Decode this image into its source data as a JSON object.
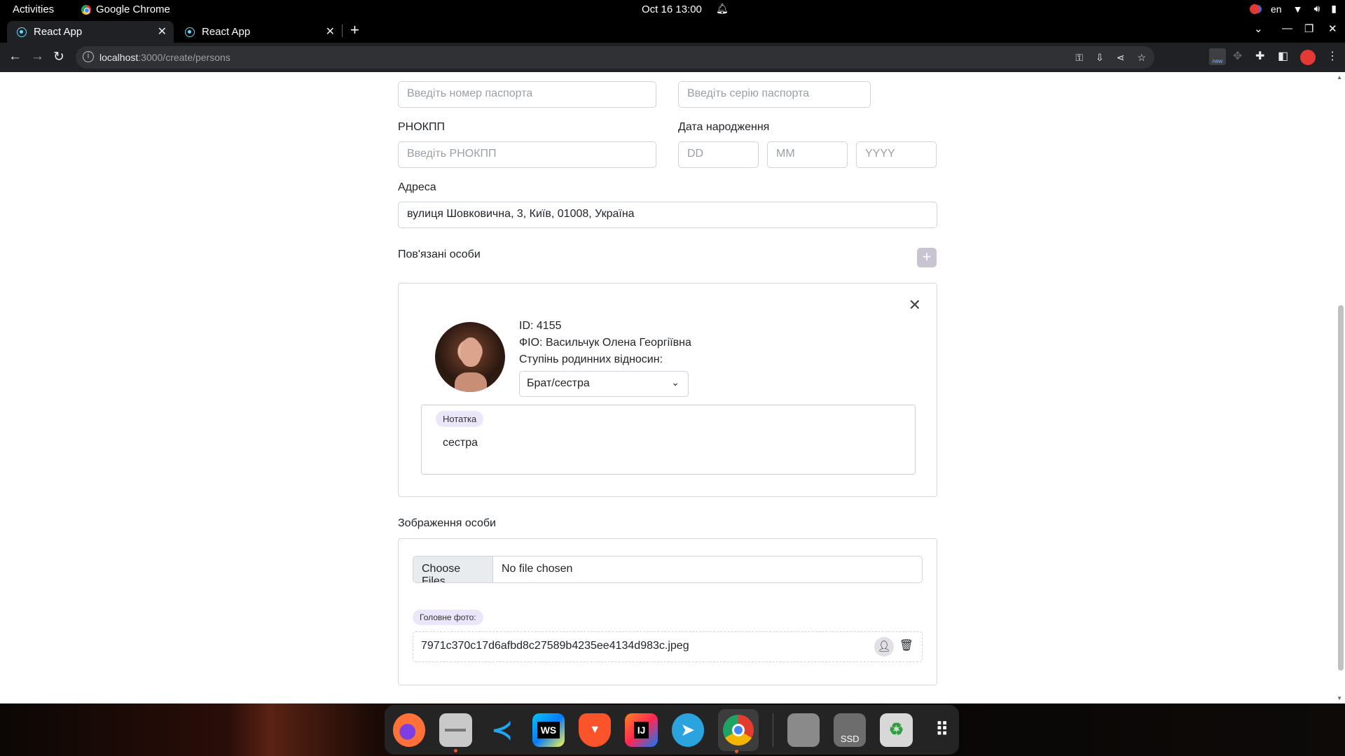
{
  "system": {
    "activities": "Activities",
    "app_name": "Google Chrome",
    "clock": "Oct 16  13:00",
    "lang": "en"
  },
  "browser": {
    "tabs": [
      {
        "label": "React App",
        "active": true
      },
      {
        "label": "React App",
        "active": false
      }
    ],
    "url_host": "localhost",
    "url_path": ":3000/create/persons",
    "new_badge": "new"
  },
  "form": {
    "passport_number_placeholder": "Введіть номер паспорта",
    "passport_series_placeholder": "Введіть серію паспорта",
    "rnokpp_label": "РНОКПП",
    "rnokpp_placeholder": "Введіть РНОКПП",
    "birthdate_label": "Дата народження",
    "dd_placeholder": "DD",
    "mm_placeholder": "MM",
    "yyyy_placeholder": "YYYY",
    "address_label": "Адреса",
    "address_value": "вулиця Шовковична, 3, Київ, 01008, Україна",
    "related_label": "Пов'язані особи",
    "add_symbol": "+"
  },
  "related_person": {
    "id_line": "ID: 4155",
    "name_line": "ФІО: Васильчук Олена Георгіївна",
    "relation_label": "Ступінь родинних відносин:",
    "relation_value": "Брат/сестра",
    "note_chip": "Нотатка",
    "note_text": "сестра"
  },
  "images": {
    "section_label": "Зображення особи",
    "choose_files": "Choose Files",
    "no_file": "No file chosen",
    "main_photo_chip": "Головне фото:",
    "file_name": "7971c370c17d6afbd8c27589b4235ee4134d983c.jpeg"
  },
  "dock": {
    "apps": [
      "firefox",
      "files",
      "vscode",
      "webstorm",
      "brave",
      "intellij",
      "telegram",
      "chrome",
      "disk",
      "ssd",
      "trash",
      "app-grid"
    ],
    "ssd_label": "SSD",
    "ws_label": "WS",
    "ij_label": "IJ"
  },
  "colors": {
    "chip_bg": "#ece6fa",
    "add_btn": "#c9c4d2",
    "chrome_bar": "#202124"
  }
}
